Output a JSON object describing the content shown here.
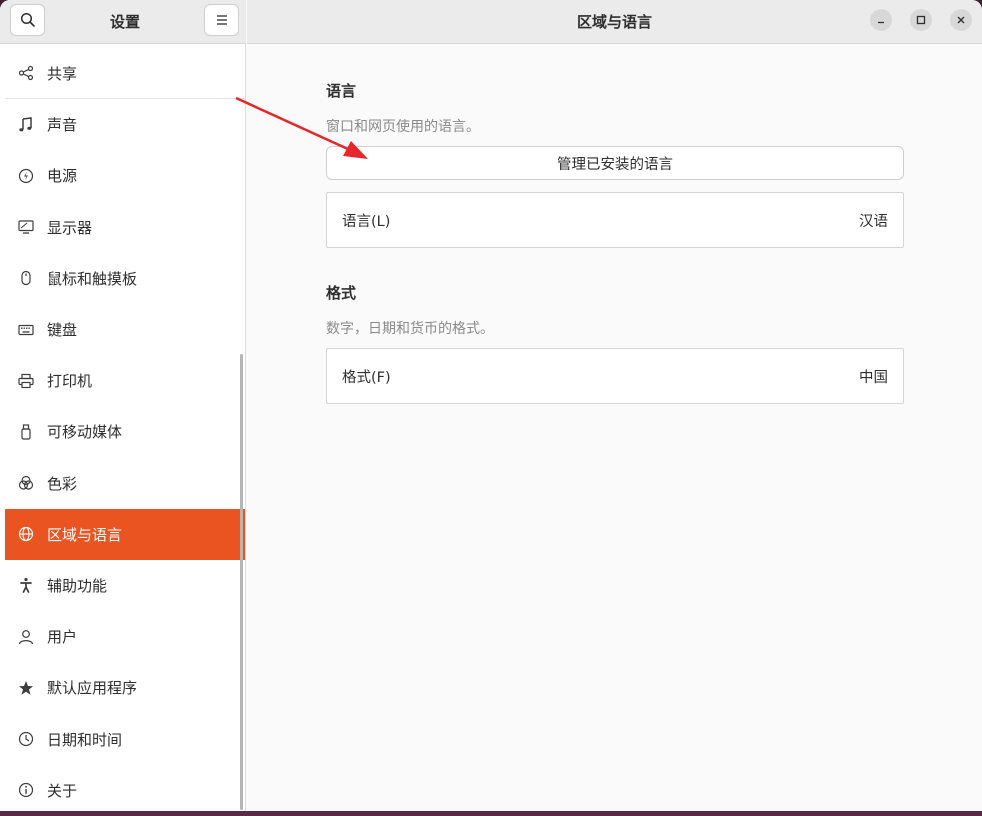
{
  "sidebar": {
    "title": "设置",
    "items": [
      {
        "label": "共享",
        "icon": "share-icon"
      },
      {
        "label": "声音",
        "icon": "music-note-icon"
      },
      {
        "label": "电源",
        "icon": "power-icon"
      },
      {
        "label": "显示器",
        "icon": "display-icon"
      },
      {
        "label": "鼠标和触摸板",
        "icon": "mouse-icon"
      },
      {
        "label": "键盘",
        "icon": "keyboard-icon"
      },
      {
        "label": "打印机",
        "icon": "printer-icon"
      },
      {
        "label": "可移动媒体",
        "icon": "usb-drive-icon"
      },
      {
        "label": "色彩",
        "icon": "color-icon"
      },
      {
        "label": "区域与语言",
        "icon": "globe-icon",
        "active": true
      },
      {
        "label": "辅助功能",
        "icon": "accessibility-icon"
      },
      {
        "label": "用户",
        "icon": "user-icon"
      },
      {
        "label": "默认应用程序",
        "icon": "star-icon"
      },
      {
        "label": "日期和时间",
        "icon": "clock-icon"
      },
      {
        "label": "关于",
        "icon": "info-icon"
      }
    ]
  },
  "main": {
    "title": "区域与语言",
    "language_section": {
      "title": "语言",
      "subtitle": "窗口和网页使用的语言。",
      "manage_button": "管理已安装的语言",
      "row_label": "语言(L)",
      "row_value": "汉语"
    },
    "format_section": {
      "title": "格式",
      "subtitle": "数字，日期和货币的格式。",
      "row_label": "格式(F)",
      "row_value": "中国"
    }
  },
  "colors": {
    "accent": "#e95420",
    "annotation_arrow": "#e8262a"
  }
}
